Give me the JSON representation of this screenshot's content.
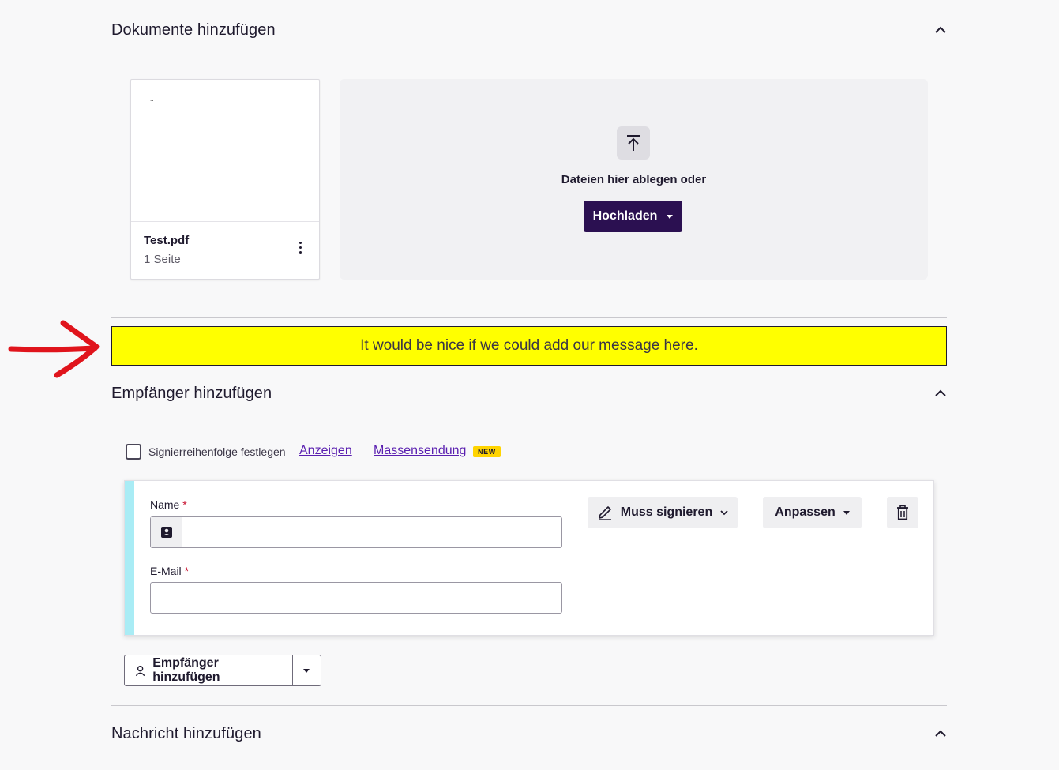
{
  "documents_section": {
    "title": "Dokumente hinzufügen",
    "file": {
      "name": "Test.pdf",
      "pages": "1 Seite",
      "preview_text": ".."
    },
    "dropzone": {
      "text": "Dateien hier ablegen oder",
      "upload_label": "Hochladen"
    }
  },
  "banner": {
    "text": "It would be nice if we could add our message here."
  },
  "recipients_section": {
    "title": "Empfänger hinzufügen",
    "signing_order_label": "Signierreihenfolge festlegen",
    "show_link": "Anzeigen",
    "bulk_send_link": "Massensendung",
    "new_badge": "NEW",
    "recipient": {
      "name_label": "Name",
      "email_label": "E-Mail",
      "required_mark": "*",
      "name_value": "",
      "email_value": "",
      "action_label": "Muss signieren",
      "customize_label": "Anpassen"
    },
    "add_recipient_label": "Empfänger hinzufügen"
  },
  "message_section": {
    "title": "Nachricht hinzufügen"
  },
  "colors": {
    "primary": "#2b1051",
    "banner": "#ffff00",
    "accent": "#a9ecf5",
    "link": "#5a1fb0",
    "annotation_arrow": "#e0141c"
  },
  "icons": [
    "chevron-up-icon",
    "upload-icon",
    "more-vertical-icon",
    "contact-card-icon",
    "pen-icon",
    "trash-icon",
    "user-icon",
    "arrow-annotation"
  ]
}
